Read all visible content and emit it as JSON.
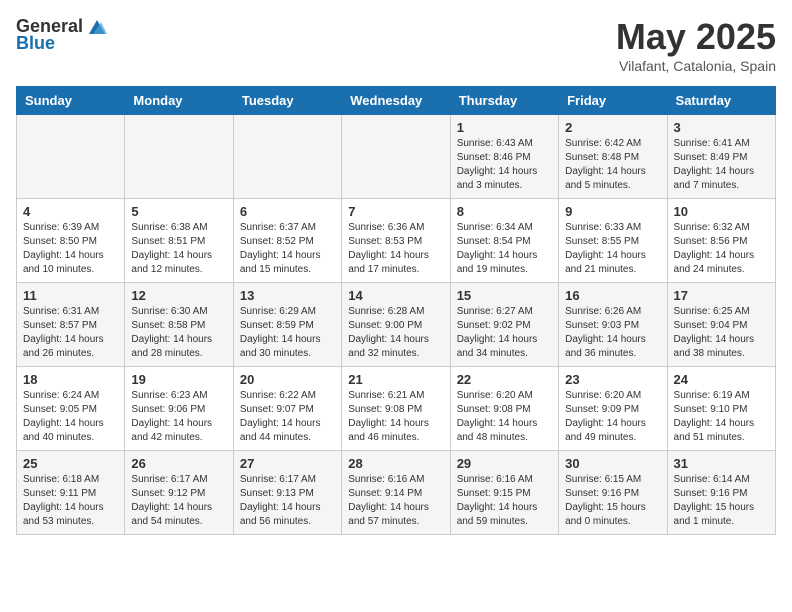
{
  "header": {
    "logo_general": "General",
    "logo_blue": "Blue",
    "month": "May 2025",
    "location": "Vilafant, Catalonia, Spain"
  },
  "weekdays": [
    "Sunday",
    "Monday",
    "Tuesday",
    "Wednesday",
    "Thursday",
    "Friday",
    "Saturday"
  ],
  "weeks": [
    [
      {
        "day": "",
        "info": ""
      },
      {
        "day": "",
        "info": ""
      },
      {
        "day": "",
        "info": ""
      },
      {
        "day": "",
        "info": ""
      },
      {
        "day": "1",
        "info": "Sunrise: 6:43 AM\nSunset: 8:46 PM\nDaylight: 14 hours\nand 3 minutes."
      },
      {
        "day": "2",
        "info": "Sunrise: 6:42 AM\nSunset: 8:48 PM\nDaylight: 14 hours\nand 5 minutes."
      },
      {
        "day": "3",
        "info": "Sunrise: 6:41 AM\nSunset: 8:49 PM\nDaylight: 14 hours\nand 7 minutes."
      }
    ],
    [
      {
        "day": "4",
        "info": "Sunrise: 6:39 AM\nSunset: 8:50 PM\nDaylight: 14 hours\nand 10 minutes."
      },
      {
        "day": "5",
        "info": "Sunrise: 6:38 AM\nSunset: 8:51 PM\nDaylight: 14 hours\nand 12 minutes."
      },
      {
        "day": "6",
        "info": "Sunrise: 6:37 AM\nSunset: 8:52 PM\nDaylight: 14 hours\nand 15 minutes."
      },
      {
        "day": "7",
        "info": "Sunrise: 6:36 AM\nSunset: 8:53 PM\nDaylight: 14 hours\nand 17 minutes."
      },
      {
        "day": "8",
        "info": "Sunrise: 6:34 AM\nSunset: 8:54 PM\nDaylight: 14 hours\nand 19 minutes."
      },
      {
        "day": "9",
        "info": "Sunrise: 6:33 AM\nSunset: 8:55 PM\nDaylight: 14 hours\nand 21 minutes."
      },
      {
        "day": "10",
        "info": "Sunrise: 6:32 AM\nSunset: 8:56 PM\nDaylight: 14 hours\nand 24 minutes."
      }
    ],
    [
      {
        "day": "11",
        "info": "Sunrise: 6:31 AM\nSunset: 8:57 PM\nDaylight: 14 hours\nand 26 minutes."
      },
      {
        "day": "12",
        "info": "Sunrise: 6:30 AM\nSunset: 8:58 PM\nDaylight: 14 hours\nand 28 minutes."
      },
      {
        "day": "13",
        "info": "Sunrise: 6:29 AM\nSunset: 8:59 PM\nDaylight: 14 hours\nand 30 minutes."
      },
      {
        "day": "14",
        "info": "Sunrise: 6:28 AM\nSunset: 9:00 PM\nDaylight: 14 hours\nand 32 minutes."
      },
      {
        "day": "15",
        "info": "Sunrise: 6:27 AM\nSunset: 9:02 PM\nDaylight: 14 hours\nand 34 minutes."
      },
      {
        "day": "16",
        "info": "Sunrise: 6:26 AM\nSunset: 9:03 PM\nDaylight: 14 hours\nand 36 minutes."
      },
      {
        "day": "17",
        "info": "Sunrise: 6:25 AM\nSunset: 9:04 PM\nDaylight: 14 hours\nand 38 minutes."
      }
    ],
    [
      {
        "day": "18",
        "info": "Sunrise: 6:24 AM\nSunset: 9:05 PM\nDaylight: 14 hours\nand 40 minutes."
      },
      {
        "day": "19",
        "info": "Sunrise: 6:23 AM\nSunset: 9:06 PM\nDaylight: 14 hours\nand 42 minutes."
      },
      {
        "day": "20",
        "info": "Sunrise: 6:22 AM\nSunset: 9:07 PM\nDaylight: 14 hours\nand 44 minutes."
      },
      {
        "day": "21",
        "info": "Sunrise: 6:21 AM\nSunset: 9:08 PM\nDaylight: 14 hours\nand 46 minutes."
      },
      {
        "day": "22",
        "info": "Sunrise: 6:20 AM\nSunset: 9:08 PM\nDaylight: 14 hours\nand 48 minutes."
      },
      {
        "day": "23",
        "info": "Sunrise: 6:20 AM\nSunset: 9:09 PM\nDaylight: 14 hours\nand 49 minutes."
      },
      {
        "day": "24",
        "info": "Sunrise: 6:19 AM\nSunset: 9:10 PM\nDaylight: 14 hours\nand 51 minutes."
      }
    ],
    [
      {
        "day": "25",
        "info": "Sunrise: 6:18 AM\nSunset: 9:11 PM\nDaylight: 14 hours\nand 53 minutes."
      },
      {
        "day": "26",
        "info": "Sunrise: 6:17 AM\nSunset: 9:12 PM\nDaylight: 14 hours\nand 54 minutes."
      },
      {
        "day": "27",
        "info": "Sunrise: 6:17 AM\nSunset: 9:13 PM\nDaylight: 14 hours\nand 56 minutes."
      },
      {
        "day": "28",
        "info": "Sunrise: 6:16 AM\nSunset: 9:14 PM\nDaylight: 14 hours\nand 57 minutes."
      },
      {
        "day": "29",
        "info": "Sunrise: 6:16 AM\nSunset: 9:15 PM\nDaylight: 14 hours\nand 59 minutes."
      },
      {
        "day": "30",
        "info": "Sunrise: 6:15 AM\nSunset: 9:16 PM\nDaylight: 15 hours\nand 0 minutes."
      },
      {
        "day": "31",
        "info": "Sunrise: 6:14 AM\nSunset: 9:16 PM\nDaylight: 15 hours\nand 1 minute."
      }
    ]
  ]
}
